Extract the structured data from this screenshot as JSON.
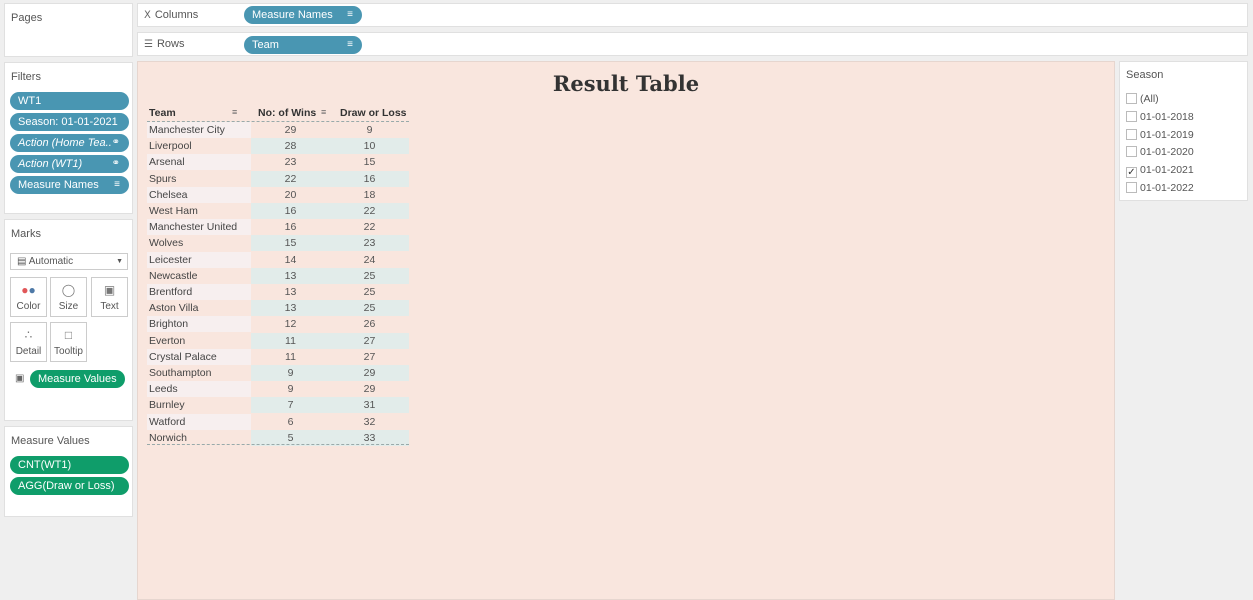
{
  "pages": {
    "title": "Pages"
  },
  "columns_shelf": {
    "label": "Columns",
    "pill": "Measure Names"
  },
  "rows_shelf": {
    "label": "Rows",
    "pill": "Team"
  },
  "filters": {
    "title": "Filters",
    "items": [
      "WT1",
      "Season: 01-01-2021",
      "Action (Home Tea..",
      "Action (WT1)",
      "Measure Names"
    ]
  },
  "marks": {
    "title": "Marks",
    "type": "Automatic",
    "buttons": [
      "Color",
      "Size",
      "Text",
      "Detail",
      "Tooltip"
    ],
    "text_pill": "Measure Values"
  },
  "measure_values": {
    "title": "Measure Values",
    "items": [
      "CNT(WT1)",
      "AGG(Draw or Loss)"
    ]
  },
  "viz": {
    "title": "Result Table",
    "headers": {
      "team": "Team",
      "wins": "No: of Wins",
      "draw_loss": "Draw or Loss"
    },
    "rows": [
      {
        "team": "Manchester City",
        "wins": "29",
        "draw_loss": "9"
      },
      {
        "team": "Liverpool",
        "wins": "28",
        "draw_loss": "10"
      },
      {
        "team": "Arsenal",
        "wins": "23",
        "draw_loss": "15"
      },
      {
        "team": "Spurs",
        "wins": "22",
        "draw_loss": "16"
      },
      {
        "team": "Chelsea",
        "wins": "20",
        "draw_loss": "18"
      },
      {
        "team": "West Ham",
        "wins": "16",
        "draw_loss": "22"
      },
      {
        "team": "Manchester United",
        "wins": "16",
        "draw_loss": "22"
      },
      {
        "team": "Wolves",
        "wins": "15",
        "draw_loss": "23"
      },
      {
        "team": "Leicester",
        "wins": "14",
        "draw_loss": "24"
      },
      {
        "team": "Newcastle",
        "wins": "13",
        "draw_loss": "25"
      },
      {
        "team": "Brentford",
        "wins": "13",
        "draw_loss": "25"
      },
      {
        "team": "Aston Villa",
        "wins": "13",
        "draw_loss": "25"
      },
      {
        "team": "Brighton",
        "wins": "12",
        "draw_loss": "26"
      },
      {
        "team": "Everton",
        "wins": "11",
        "draw_loss": "27"
      },
      {
        "team": "Crystal Palace",
        "wins": "11",
        "draw_loss": "27"
      },
      {
        "team": "Southampton",
        "wins": "9",
        "draw_loss": "29"
      },
      {
        "team": "Leeds",
        "wins": "9",
        "draw_loss": "29"
      },
      {
        "team": "Burnley",
        "wins": "7",
        "draw_loss": "31"
      },
      {
        "team": "Watford",
        "wins": "6",
        "draw_loss": "32"
      },
      {
        "team": "Norwich",
        "wins": "5",
        "draw_loss": "33"
      }
    ]
  },
  "season_filter": {
    "title": "Season",
    "options": [
      {
        "label": "(All)",
        "checked": false
      },
      {
        "label": "01-01-2018",
        "checked": false
      },
      {
        "label": "01-01-2019",
        "checked": false
      },
      {
        "label": "01-01-2020",
        "checked": false
      },
      {
        "label": "01-01-2021",
        "checked": true
      },
      {
        "label": "01-01-2022",
        "checked": false
      }
    ]
  },
  "colors": {
    "dimension_pill": "#4996b2",
    "measure_pill": "#0f9d6a",
    "canvas_bg": "#f9e6de",
    "band_alt": "#e2ecea"
  }
}
